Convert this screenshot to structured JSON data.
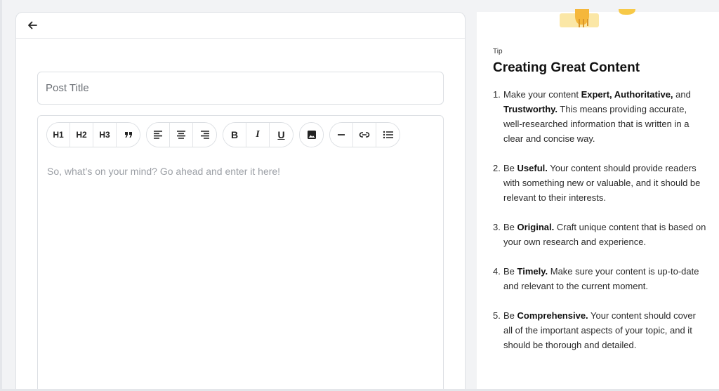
{
  "editor": {
    "title_placeholder": "Post Title",
    "body_placeholder": "So, what’s on your mind? Go ahead and enter it here!",
    "toolbar": {
      "h1": "H1",
      "h2": "H2",
      "h3": "H3",
      "bold": "B",
      "italic": "I",
      "underline": "U"
    }
  },
  "tip": {
    "label": "Tip",
    "heading": "Creating Great Content",
    "items": [
      {
        "num": "1.",
        "pre": "Make your content ",
        "b1": "Expert, Authoritative,",
        "mid": " and ",
        "b2": "Trustworthy.",
        "post": " This means providing accurate, well-researched information that is written in a clear and concise way."
      },
      {
        "num": "2.",
        "pre": "Be ",
        "b1": "Useful.",
        "post": " Your content should provide readers with something new or valuable, and it should be relevant to their interests."
      },
      {
        "num": "3.",
        "pre": "Be ",
        "b1": "Original.",
        "post": " Craft unique content that is based on your own research and experience."
      },
      {
        "num": "4.",
        "pre": "Be ",
        "b1": "Timely.",
        "post": " Make sure your content is up-to-date and relevant to the current moment."
      },
      {
        "num": "5.",
        "pre": "Be ",
        "b1": "Comprehensive.",
        "post": " Your content should cover all of the important aspects of your topic, and it should be thorough and detailed."
      }
    ]
  },
  "icons": {
    "back": "arrow-left-icon",
    "quote": "quote-icon",
    "align_left": "align-left-icon",
    "align_center": "align-center-icon",
    "align_right": "align-right-icon",
    "image": "image-icon",
    "hr": "horizontal-rule-icon",
    "link": "link-icon",
    "list": "bullet-list-icon"
  },
  "colors": {
    "background": "#f2f3f5",
    "illustration_yellow": "#f7c948",
    "illustration_pale": "#fbe7a6"
  }
}
